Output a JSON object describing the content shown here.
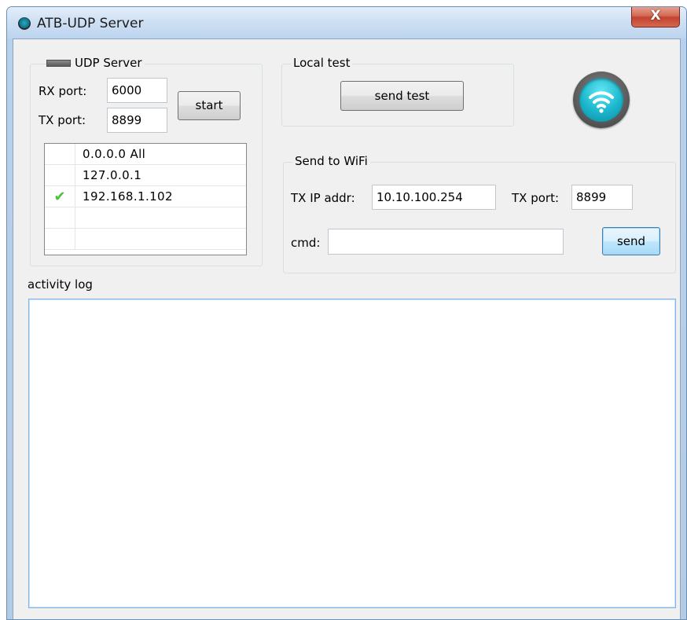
{
  "window": {
    "title": "ATB-UDP Server",
    "close_glyph": "X",
    "icon": "app-round-icon"
  },
  "udp_server": {
    "legend": "UDP Server",
    "indicator_color": "#6e6e6e",
    "rx_port_label": "RX port:",
    "rx_port_value": "6000",
    "tx_port_label": "TX port:",
    "tx_port_value": "8899",
    "start_label": "start",
    "ip_list": [
      {
        "address": "0.0.0.0 All",
        "checked": false
      },
      {
        "address": "127.0.0.1",
        "checked": false
      },
      {
        "address": "192.168.1.102",
        "checked": true
      }
    ],
    "check_glyph": "✔"
  },
  "local_test": {
    "legend": "Local test",
    "send_test_label": "send test"
  },
  "wifi_icon": {
    "name": "wifi-icon",
    "color": "#1fb7cc"
  },
  "send_to_wifi": {
    "legend": "Send to WiFi",
    "tx_ip_label": "TX IP addr:",
    "tx_ip_value": "10.10.100.254",
    "tx_port_label": "TX port:",
    "tx_port_value": "8899",
    "cmd_label": "cmd:",
    "cmd_value": "",
    "send_label": "send"
  },
  "activity_log": {
    "label": "activity log",
    "content": ""
  }
}
